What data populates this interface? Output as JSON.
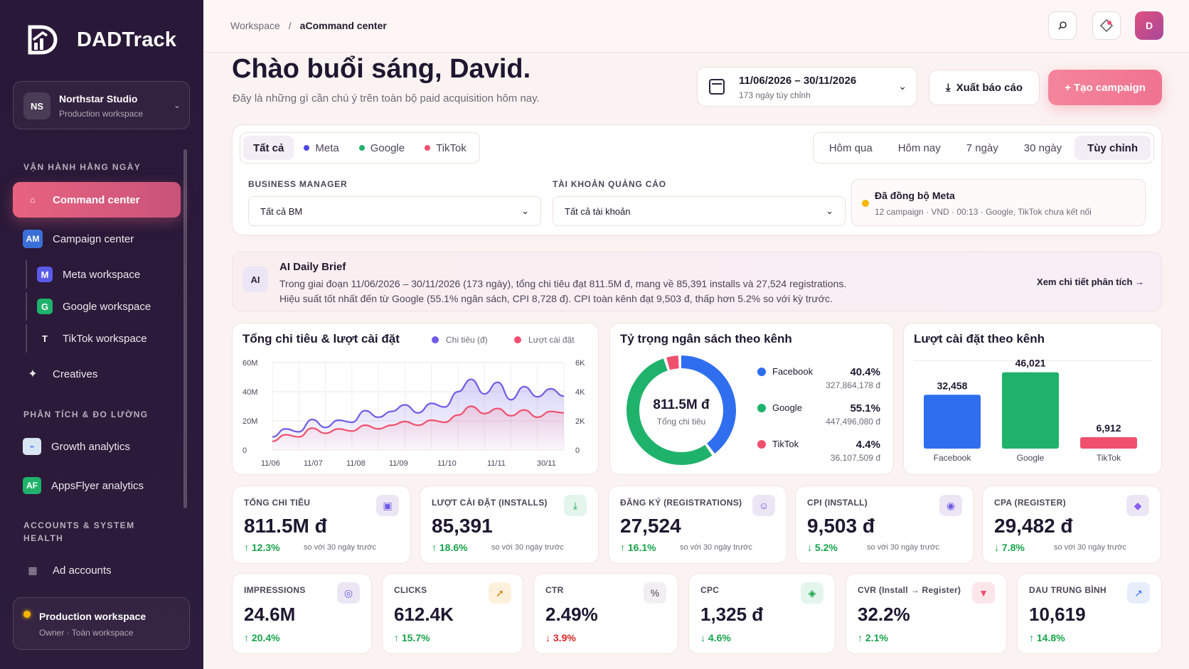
{
  "app": {
    "name": "DADTrack"
  },
  "workspace": {
    "initials": "NS",
    "name": "Northstar Studio",
    "sub": "Production workspace"
  },
  "sidebar": {
    "sections": [
      "VẬN HÀNH HẰNG NGÀY",
      "PHÂN TÍCH & ĐO LƯỜNG",
      "ACCOUNTS & SYSTEM",
      "HEALTH"
    ],
    "items": [
      {
        "label": "Command center",
        "icon": "home-icon"
      },
      {
        "label": "Campaign center",
        "icon": "am-icon",
        "badge": "AM"
      },
      {
        "label": "Meta workspace",
        "badge": "M"
      },
      {
        "label": "Google workspace",
        "badge": "G"
      },
      {
        "label": "TikTok workspace",
        "badge": "T"
      },
      {
        "label": "Creatives",
        "icon": "sparkle-icon"
      },
      {
        "label": "Growth analytics",
        "icon": "chart-icon"
      },
      {
        "label": "AppsFlyer analytics",
        "badge": "AF"
      },
      {
        "label": "Ad accounts",
        "icon": "grid-icon"
      }
    ],
    "footer": {
      "name": "Production workspace",
      "sub": "Owner · Toàn workspace"
    }
  },
  "header": {
    "crumb_root": "Workspace",
    "crumb_sep": "/",
    "crumb_current": "aCommand center",
    "avatar": "D"
  },
  "greeting": {
    "title": "Chào buổi sáng, David.",
    "subtitle": "Đây là những gì cần chú ý trên toàn bộ paid acquisition hôm nay."
  },
  "date_range": {
    "range": "11/06/2026 – 30/11/2026",
    "sub": "173 ngày tùy chỉnh"
  },
  "actions": {
    "export": "Xuất báo cáo",
    "create": "+ Tạo campaign"
  },
  "filters": {
    "channels": [
      "Tất cả",
      "Meta",
      "Google",
      "TikTok"
    ],
    "periods": [
      "Hôm qua",
      "Hôm nay",
      "7 ngày",
      "30 ngày",
      "Tùy chỉnh"
    ],
    "bm_label": "BUSINESS MANAGER",
    "bm_value": "Tất cả BM",
    "acct_label": "TÀI KHOẢN QUẢNG CÁO",
    "acct_value": "Tất cả tài khoản",
    "sync_title": "Đã đồng bộ Meta",
    "sync_sub": "12 campaign · VND · 00:13 · Google, TikTok chưa kết nối"
  },
  "ai": {
    "badge": "AI",
    "title": "AI Daily Brief",
    "line1": "Trong giai đoạn 11/06/2026 – 30/11/2026 (173 ngày), tổng chi tiêu đạt 811.5M đ, mang về 85,391 installs và 27,524 registrations.",
    "line2": "Hiệu suất tốt nhất đến từ Google (55.1% ngân sách, CPI 8,728 đ). CPI toàn kênh đạt 9,503 đ, thấp hơn 5.2% so với kỳ trước.",
    "link": "Xem chi tiết phân tích →"
  },
  "chart_data": [
    {
      "type": "line",
      "title": "Tổng chi tiêu & lượt cài đặt",
      "x": [
        "11/06",
        "11/07",
        "11/08",
        "11/09",
        "11/10",
        "11/11",
        "30/11"
      ],
      "y_left_ticks": [
        "60M",
        "40M",
        "20M",
        "0"
      ],
      "y_right_ticks": [
        "6K",
        "4K",
        "2K",
        "0"
      ],
      "ylim": [
        0,
        60000000
      ],
      "ylim_right": [
        0,
        6000
      ],
      "series": [
        {
          "name": "Chi tiêu (đ)",
          "color": "#6d5ce8",
          "axis": "left",
          "values": [
            9000000,
            14500000,
            12500000,
            21000000,
            15500000,
            20500000,
            19000000,
            27000000,
            22500000,
            26500000,
            31000000,
            25500000,
            32000000,
            29500000,
            40000000,
            48500000,
            38500000,
            46500000,
            34500000,
            43500000,
            36500000,
            42000000,
            37000000
          ]
        },
        {
          "name": "Lượt cài đặt",
          "color": "#f0506e",
          "axis": "right",
          "values": [
            600,
            1050,
            900,
            1500,
            1150,
            1450,
            1300,
            1700,
            1450,
            1700,
            1950,
            1700,
            2050,
            1900,
            2400,
            3000,
            2500,
            2850,
            2350,
            2750,
            2250,
            2650,
            2550
          ]
        }
      ]
    },
    {
      "type": "pie",
      "title": "Tỷ trọng ngân sách theo kênh",
      "center_value": "811.5M đ",
      "center_label": "Tổng chi tiêu",
      "slices": [
        {
          "name": "Facebook",
          "percent": 40.4,
          "pct_label": "40.4%",
          "amount": "327,864,178 đ",
          "color": "#2f6fef"
        },
        {
          "name": "Google",
          "percent": 55.1,
          "pct_label": "55.1%",
          "amount": "447,496,080 đ",
          "color": "#1fb26b"
        },
        {
          "name": "TikTok",
          "percent": 4.4,
          "pct_label": "4.4%",
          "amount": "36,107,509 đ",
          "color": "#f0506e"
        }
      ]
    },
    {
      "type": "bar",
      "title": "Lượt cài đặt theo kênh",
      "categories": [
        "Facebook",
        "Google",
        "TikTok"
      ],
      "values": [
        32458,
        46021,
        6912
      ],
      "labels": [
        "32,458",
        "46,021",
        "6,912"
      ],
      "colors": [
        "#2f6fef",
        "#1fb26b",
        "#f0506e"
      ],
      "ylim": [
        0,
        48000
      ]
    }
  ],
  "kpis_row1": [
    {
      "label": "TỔNG CHI TIÊU",
      "value": "811.5M đ",
      "change": "12.3%",
      "dir": "up",
      "cmp": "so với 30 ngày trước",
      "icon": "doc-icon",
      "icon_glyph": "▣",
      "icon_bg": "#ece6f4",
      "icon_color": "#6d5ce8"
    },
    {
      "label": "LƯỢT CÀI ĐẶT (INSTALLS)",
      "value": "85,391",
      "change": "18.6%",
      "dir": "up",
      "cmp": "so với 30 ngày trước",
      "icon": "download-icon",
      "icon_glyph": "⤓",
      "icon_bg": "#e4f5ec",
      "icon_color": "#16a34a"
    },
    {
      "label": "ĐĂNG KÝ (REGISTRATIONS)",
      "value": "27,524",
      "change": "16.1%",
      "dir": "up",
      "cmp": "so với 30 ngày trước",
      "icon": "user-icon",
      "icon_glyph": "☺",
      "icon_bg": "#ece6f4",
      "icon_color": "#6d5ce8"
    },
    {
      "label": "CPI (INSTALL)",
      "value": "9,503 đ",
      "change": "5.2%",
      "dir": "down-good",
      "cmp": "so với 30 ngày trước",
      "icon": "target-icon",
      "icon_glyph": "◉",
      "icon_bg": "#ece6f4",
      "icon_color": "#6d5ce8"
    },
    {
      "label": "CPA (REGISTER)",
      "value": "29,482 đ",
      "change": "7.8%",
      "dir": "down-good",
      "cmp": "so với 30 ngày trước",
      "icon": "diamond-icon",
      "icon_glyph": "◆",
      "icon_bg": "#ece6f4",
      "icon_color": "#8b5cf6"
    }
  ],
  "kpis_row2": [
    {
      "label": "IMPRESSIONS",
      "value": "24.6M",
      "change": "20.4%",
      "dir": "up",
      "icon": "eye-icon",
      "icon_glyph": "◎",
      "icon_bg": "#ece6f4",
      "icon_color": "#6d5ce8"
    },
    {
      "label": "CLICKS",
      "value": "612.4K",
      "change": "15.7%",
      "dir": "up",
      "icon": "cursor-icon",
      "icon_glyph": "➚",
      "icon_bg": "#fdf1dc",
      "icon_color": "#d97706"
    },
    {
      "label": "CTR",
      "value": "2.49%",
      "change": "3.9%",
      "dir": "down",
      "icon": "percent-icon",
      "icon_glyph": "%",
      "icon_bg": "#f1eff2",
      "icon_color": "#4a4558"
    },
    {
      "label": "CPC",
      "value": "1,325 đ",
      "change": "4.6%",
      "dir": "down-good",
      "icon": "tag-icon",
      "icon_glyph": "◈",
      "icon_bg": "#e4f5ec",
      "icon_color": "#16a34a"
    },
    {
      "label": "CVR (Install → Register)",
      "value": "32.2%",
      "change": "2.1%",
      "dir": "up",
      "icon": "filter-icon",
      "icon_glyph": "▼",
      "icon_bg": "#fde6ea",
      "icon_color": "#f0506e"
    },
    {
      "label": "DAU TRUNG BÌNH",
      "value": "10,619",
      "change": "14.8%",
      "dir": "up",
      "icon": "trend-icon",
      "icon_glyph": "↗",
      "icon_bg": "#e6eefc",
      "icon_color": "#2f6fef"
    }
  ]
}
